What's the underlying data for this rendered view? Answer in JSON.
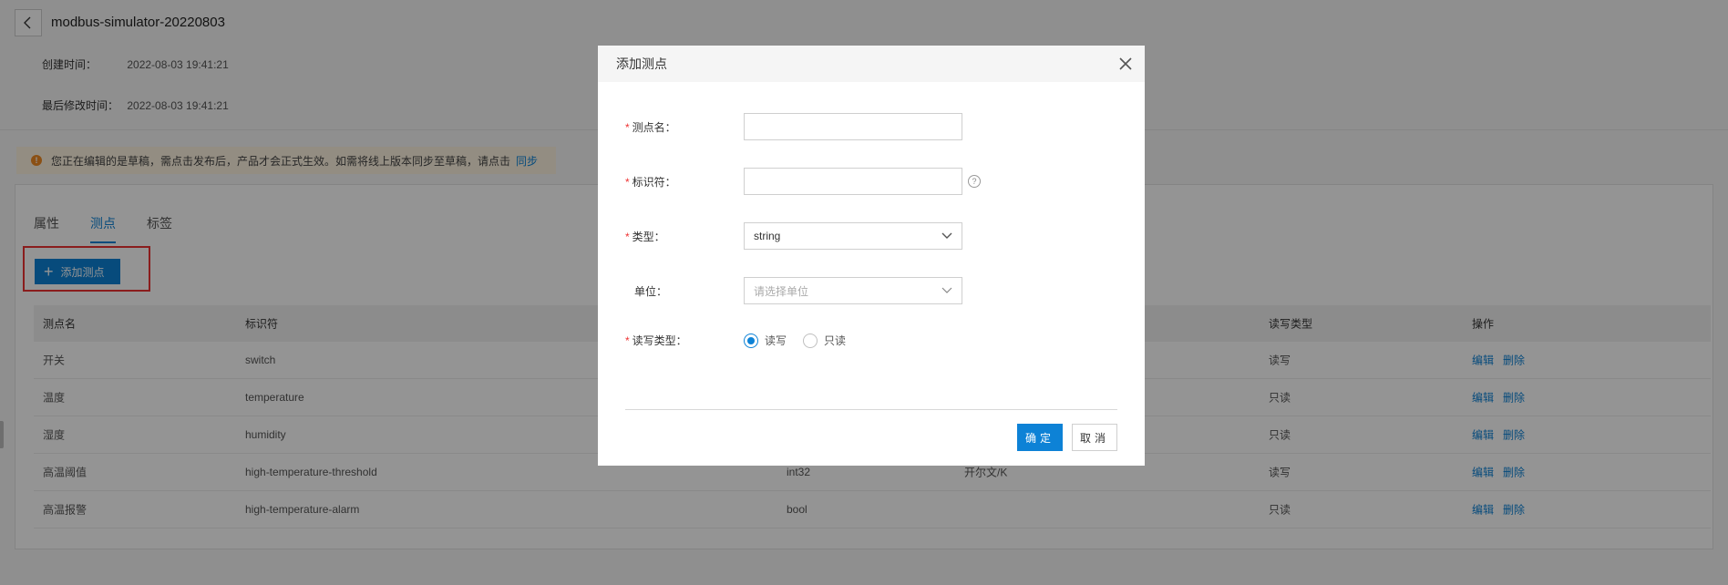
{
  "header": {
    "title": "modbus-simulator-20220803",
    "created_label": "创建时间：",
    "created_value": "2022-08-03 19:41:21",
    "modified_label": "最后修改时间：",
    "modified_value": "2022-08-03 19:41:21"
  },
  "notice": {
    "text": "您正在编辑的是草稿，需点击发布后，产品才会正式生效。如需将线上版本同步至草稿，请点击",
    "link": "同步"
  },
  "tabs": [
    "属性",
    "测点",
    "标签"
  ],
  "active_tab": "测点",
  "add_button_label": "添加测点",
  "table": {
    "columns": [
      "测点名",
      "标识符",
      "读写类型",
      "操作"
    ],
    "rows": [
      {
        "name": "开关",
        "id": "switch",
        "type": "",
        "unit": "",
        "rw": "读写"
      },
      {
        "name": "温度",
        "id": "temperature",
        "type": "",
        "unit": "",
        "rw": "只读"
      },
      {
        "name": "湿度",
        "id": "humidity",
        "type": "",
        "unit": "",
        "rw": "只读"
      },
      {
        "name": "高温阈值",
        "id": "high-temperature-threshold",
        "type": "int32",
        "unit": "开尔文/K",
        "rw": "读写"
      },
      {
        "name": "高温报警",
        "id": "high-temperature-alarm",
        "type": "bool",
        "unit": "",
        "rw": "只读"
      }
    ],
    "edit_label": "编辑",
    "delete_label": "删除"
  },
  "modal": {
    "title": "添加测点",
    "fields": {
      "name_label": "测点名：",
      "name_value": "",
      "identifier_label": "标识符：",
      "identifier_value": "",
      "type_label": "类型：",
      "type_value": "string",
      "unit_label": "单位：",
      "unit_placeholder": "请选择单位",
      "rw_label": "读写类型：",
      "rw_options": [
        "读写",
        "只读"
      ],
      "rw_selected": "读写"
    },
    "ok_label": "确定",
    "cancel_label": "取消"
  },
  "colors": {
    "primary": "#0d82d6",
    "required": "#ee3333",
    "highlight": "#ee3333",
    "warning": "#f08a24"
  }
}
